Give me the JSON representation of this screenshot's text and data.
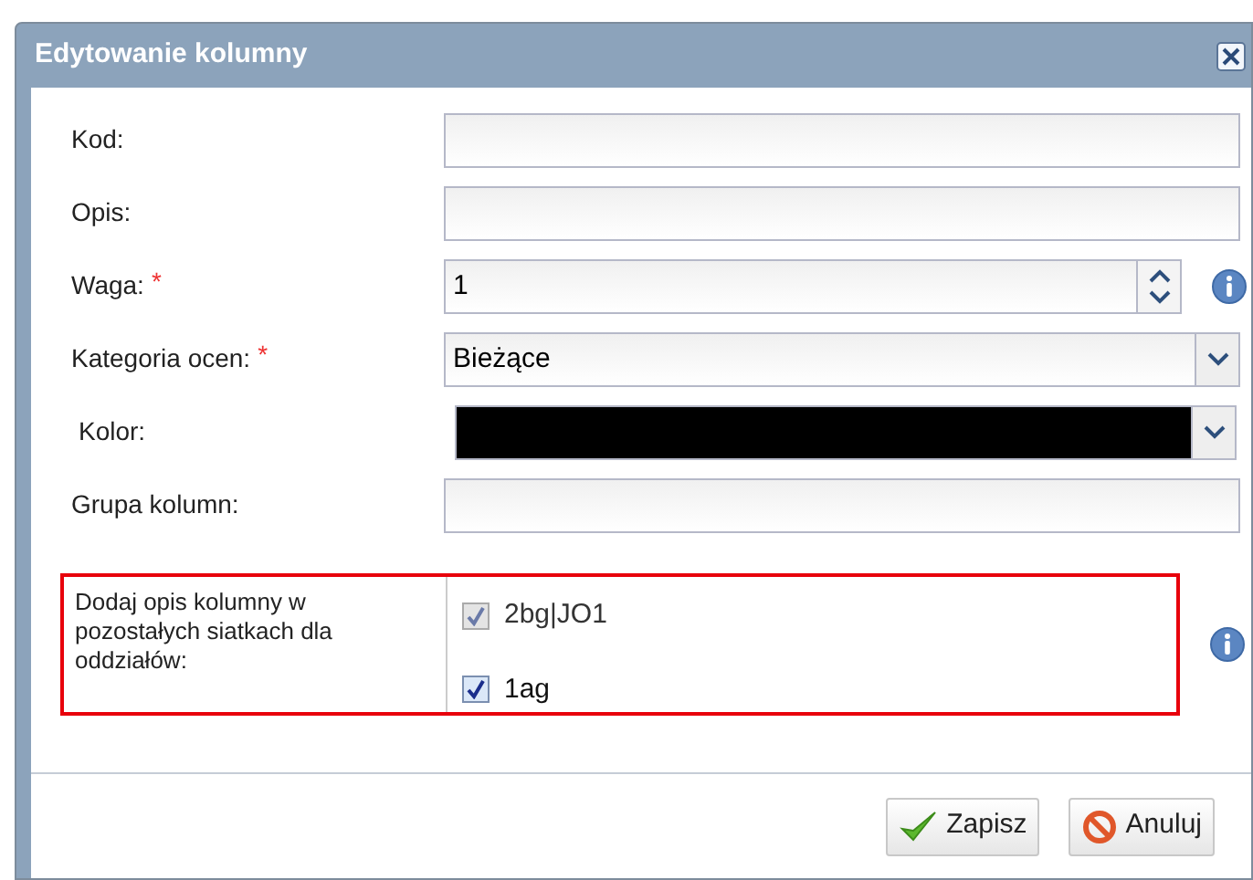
{
  "window": {
    "title": "Edytowanie kolumny"
  },
  "fields": [
    {
      "kind": "text",
      "label": "Kod:",
      "info": false
    },
    {
      "kind": "text",
      "label": "Opis:",
      "info": false
    },
    {
      "kind": "spinner",
      "label": "Waga:",
      "required_mark": "*",
      "value": "1",
      "info": true
    },
    {
      "kind": "select",
      "label": "Kategoria ocen:",
      "required_mark": "*",
      "value": "Bieżące",
      "info": false
    },
    {
      "kind": "color",
      "label": "Kolor:",
      "color": "#000000",
      "info": false
    },
    {
      "kind": "text",
      "label": "Grupa kolumn:",
      "info": false
    }
  ],
  "sections": {
    "label": "Dodaj opis kolumny w pozostałych siatkach dla oddziałów:",
    "options": [
      {
        "label": "2bg|JO1",
        "checked": true,
        "disabled": true
      },
      {
        "label": "1ag",
        "checked": true,
        "disabled": false
      }
    ],
    "info": true
  },
  "buttons": [
    {
      "kind": "save",
      "label": "Zapisz"
    },
    {
      "kind": "cancel",
      "label": "Anuluj"
    }
  ]
}
